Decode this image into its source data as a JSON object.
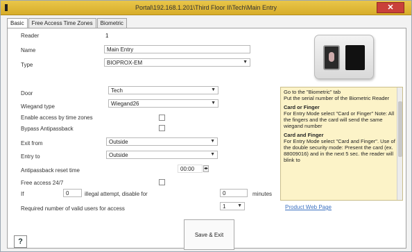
{
  "window": {
    "title": "Portal\\192.168.1.201\\Third Floor II\\Tech\\Main Entry",
    "close_label": "✕"
  },
  "tabs": [
    {
      "label": "Basic"
    },
    {
      "label": "Free Access Time Zones"
    },
    {
      "label": "Biometric"
    }
  ],
  "form": {
    "reader_label": "Reader",
    "reader_value": "1",
    "name_label": "Name",
    "name_value": "Main Entry",
    "type_label": "Type",
    "type_value": "BIOPROX-EM",
    "door_label": "Door",
    "door_value": "Tech",
    "wiegand_label": "Wiegand type",
    "wiegand_value": "Wiegand26",
    "enable_access_label": "Enable access by time zones",
    "bypass_label": "Bypass Antipassback",
    "exit_label": "Exit from",
    "exit_value": "Outside",
    "entry_label": "Entry to",
    "entry_value": "Outside",
    "antipassback_label": "Antipassback reset time",
    "antipassback_value": "00:00",
    "free_access_label": "Free access 24/7",
    "if_label": "If",
    "if_value": "0",
    "illegal_label": "illegal attempt, disable for",
    "minutes_value": "0",
    "minutes_label": "minutes",
    "required_label": "Required number of valid users for access",
    "required_value": "1"
  },
  "help": {
    "intro1": "Go to the \"Biometric\" tab",
    "intro2": "Put the serial number of the Biometric Reader",
    "card_or_finger_title": "Card or Finger",
    "card_or_finger_text": "For Entry Mode select \"Card or Finger\" Note: All the fingers and the card will send the same wiegand number",
    "card_and_finger_title": "Card and Finger",
    "card_and_finger_text": "For Entry Mode select \"Card and Finger\". Use of the double security mode: Present the card (ex. 88009016) and in the next 5 sec. the reader will blink to"
  },
  "product_link": "Product Web Page",
  "save_label": "Save & Exit",
  "help_button": "?"
}
